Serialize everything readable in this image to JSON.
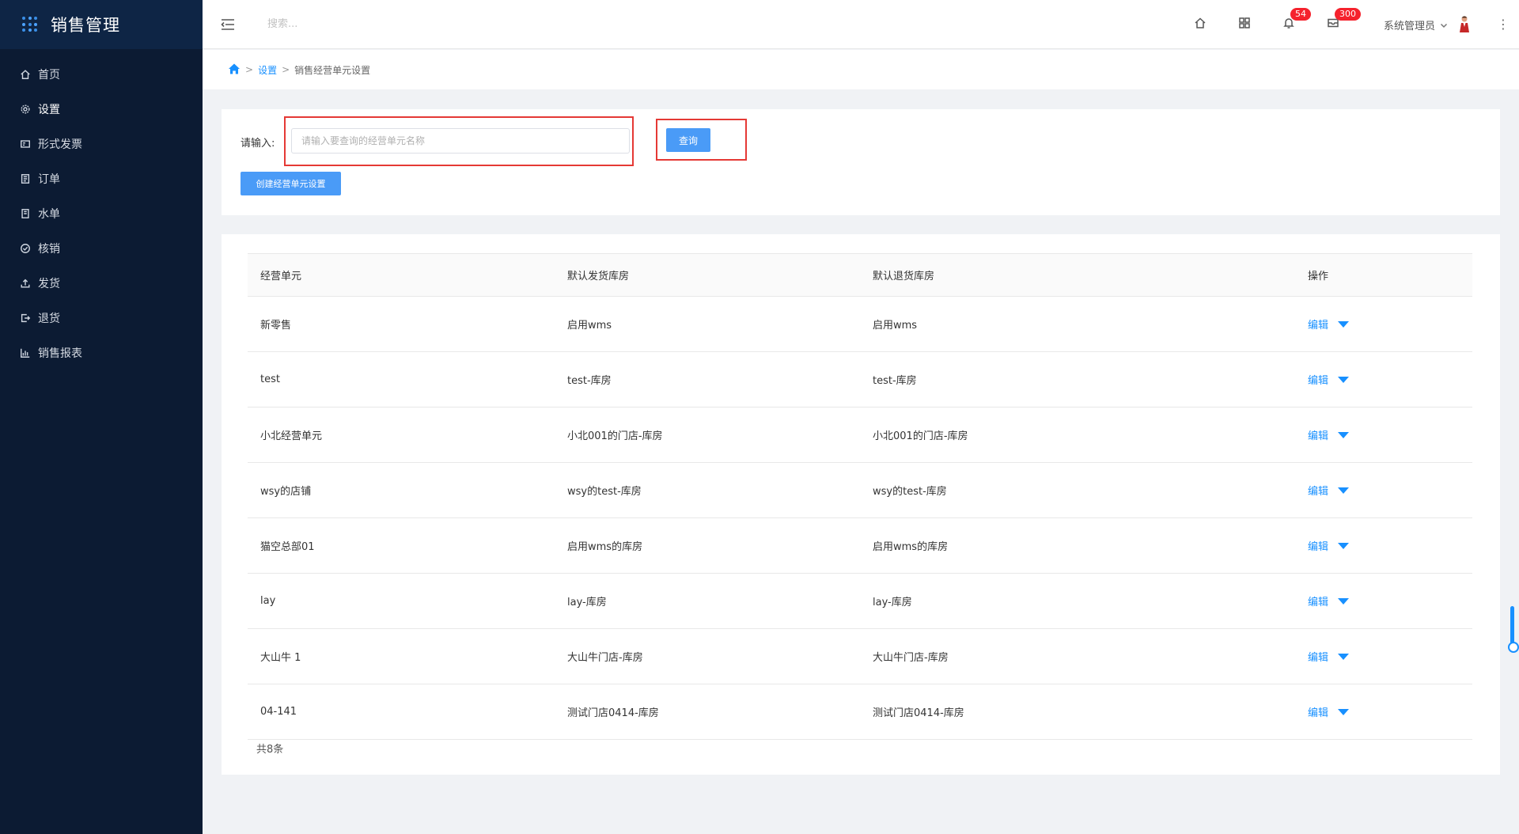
{
  "app": {
    "title": "销售管理"
  },
  "sidebar": {
    "items": [
      {
        "label": "首页",
        "icon": "home-icon"
      },
      {
        "label": "设置",
        "icon": "gear-icon"
      },
      {
        "label": "形式发票",
        "icon": "invoice-icon"
      },
      {
        "label": "订单",
        "icon": "order-icon"
      },
      {
        "label": "水单",
        "icon": "receipt-icon"
      },
      {
        "label": "核销",
        "icon": "check-circle-icon"
      },
      {
        "label": "发货",
        "icon": "upload-icon"
      },
      {
        "label": "退货",
        "icon": "return-icon"
      },
      {
        "label": "销售报表",
        "icon": "bar-chart-icon"
      }
    ],
    "active": "设置"
  },
  "topbar": {
    "search_placeholder": "搜索...",
    "notifications_count": "54",
    "messages_count": "300",
    "user_name": "系统管理员"
  },
  "breadcrumb": {
    "parent": "设置",
    "current": "销售经营单元设置"
  },
  "search_panel": {
    "label": "请输入:",
    "input_placeholder": "请输入要查询的经营单元名称",
    "input_value": "",
    "query_button": "查询",
    "create_button": "创建经营单元设置"
  },
  "table": {
    "headers": [
      "经营单元",
      "默认发货库房",
      "默认退货库房",
      "操作"
    ],
    "edit_label": "编辑",
    "rows": [
      [
        "新零售",
        "启用wms",
        "启用wms"
      ],
      [
        "test",
        "test-库房",
        "test-库房"
      ],
      [
        "小北经营单元",
        "小北001的门店-库房",
        "小北001的门店-库房"
      ],
      [
        "wsy的店铺",
        "wsy的test-库房",
        "wsy的test-库房"
      ],
      [
        "猫空总部01",
        "启用wms的库房",
        "启用wms的库房"
      ],
      [
        "lay",
        "lay-库房",
        "lay-库房"
      ],
      [
        "大山牛 1",
        "大山牛门店-库房",
        "大山牛门店-库房"
      ],
      [
        "04-141",
        "测试门店0414-库房",
        "测试门店0414-库房"
      ]
    ],
    "total": "共8条"
  },
  "colors": {
    "sidebar_bg": "#0c1b33",
    "accent": "#1890ff",
    "button": "#4a9bf7",
    "badge": "#f5222d",
    "highlight_box": "#e53935"
  }
}
